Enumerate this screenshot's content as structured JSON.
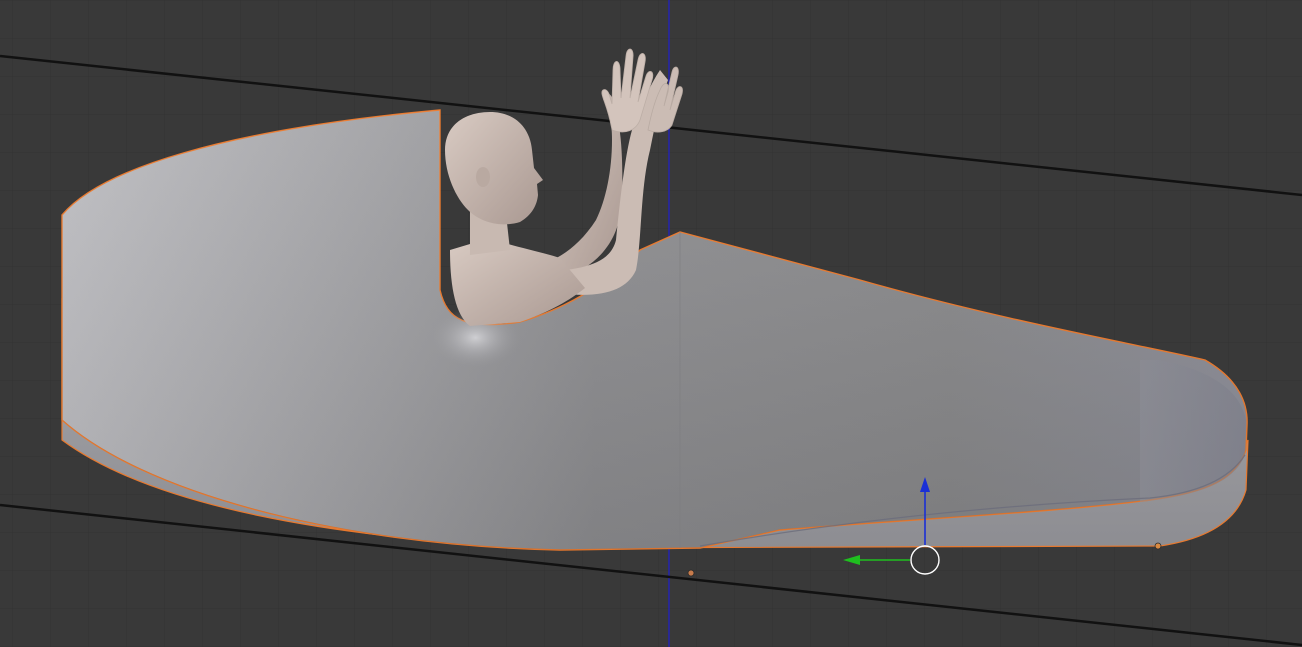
{
  "viewport": {
    "view": "3d-viewport-side",
    "selected_object": "vehicle-shell",
    "background_color": "#393939",
    "grid_color": "#333333",
    "selection_outline_color": "#e8792e",
    "axis_z_color": "#1f1fcc",
    "gizmo_x_color": "#1fbf1f",
    "gizmo_z_color": "#1a2fd6"
  },
  "scene": {
    "objects": [
      "vehicle-shell",
      "human-figure",
      "ground-line-top",
      "ground-line-bottom"
    ]
  },
  "icons": {
    "transform_gizmo": "transform-gizmo-icon",
    "pivot": "object-origin-icon"
  }
}
